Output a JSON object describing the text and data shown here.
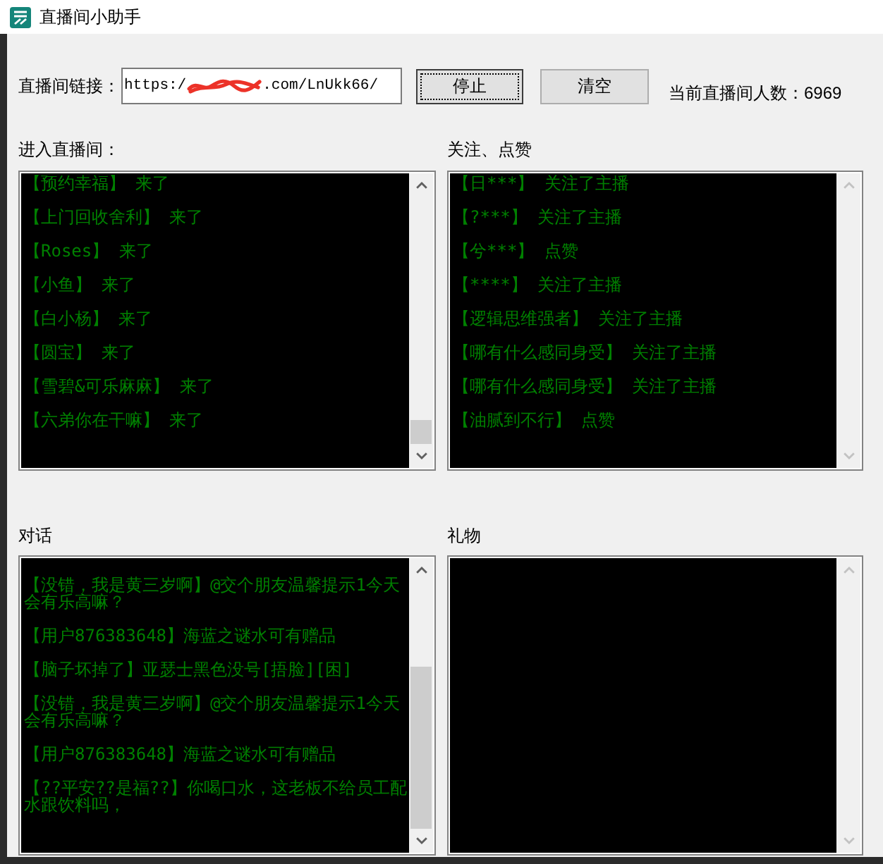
{
  "window": {
    "title": "直播间小助手"
  },
  "link": {
    "label": "直播间链接：",
    "value_start": "https:/",
    "redacted": true,
    "value_end": ".com/LnUkk66/"
  },
  "buttons": [
    {
      "label": "停止",
      "focused": true
    },
    {
      "label": "清空",
      "focused": false
    }
  ],
  "viewer_count": "当前直播间人数：6969",
  "panels": [
    {
      "title": "进入直播间：",
      "scrollable": true,
      "messages": [
        "【预约幸福】 来了",
        "【上门回收舍利】 来了",
        "【Roses】 来了",
        "【小鱼】 来了",
        "【白小杨】 来了",
        "【圆宝】 来了",
        "【雪碧&可乐麻麻】 来了",
        "【六弟你在干嘛】 来了"
      ]
    },
    {
      "title": "关注、点赞",
      "scrollable": false,
      "messages": [
        "【日***】 关注了主播",
        "【?***】 关注了主播",
        "【兮***】 点赞",
        "【****】 关注了主播",
        "【逻辑思维强者】 关注了主播",
        "【哪有什么感同身受】 关注了主播",
        "【哪有什么感同身受】 关注了主播",
        "【油腻到不行】 点赞"
      ]
    },
    {
      "title": "对话",
      "scrollable": true,
      "messages": [
        "【没错，我是黄三岁啊】@交个朋友温馨提示1今天会有乐高嘛？",
        "【用户876383648】海蓝之谜水可有赠品",
        "【脑子坏掉了】亚瑟士黑色没号[捂脸][困]",
        "【没错，我是黄三岁啊】@交个朋友温馨提示1今天会有乐高嘛？",
        "【用户876383648】海蓝之谜水可有赠品",
        "【??平安??是福??】你喝口水，这老板不给员工配水跟饮料吗，"
      ]
    },
    {
      "title": "礼物",
      "scrollable": false
    }
  ]
}
